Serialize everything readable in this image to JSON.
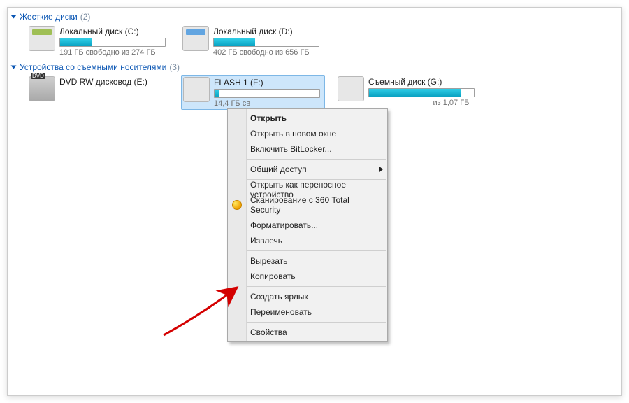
{
  "sections": {
    "hdd": {
      "title": "Жесткие диски",
      "count": "(2)"
    },
    "removable": {
      "title": "Устройства со съемными носителями",
      "count": "(3)"
    }
  },
  "drives": {
    "c": {
      "title": "Локальный диск (C:)",
      "sub": "191 ГБ свободно из 274 ГБ"
    },
    "d": {
      "title": "Локальный диск (D:)",
      "sub": "402 ГБ свободно из 656 ГБ"
    },
    "dvd": {
      "title": "DVD RW дисковод (E:)",
      "sub": ""
    },
    "f": {
      "title": "FLASH 1 (F:)",
      "sub": "14,4 ГБ св"
    },
    "g": {
      "title": "Съемный диск (G:)",
      "sub_suffix": " из 1,07 ГБ"
    }
  },
  "context_menu": {
    "open": "Открыть",
    "open_new": "Открыть в новом окне",
    "bitlocker": "Включить BitLocker...",
    "sharing": "Общий доступ",
    "portable": "Открыть как переносное устройство",
    "scan360": "Сканирование с 360 Total Security",
    "format": "Форматировать...",
    "eject": "Извлечь",
    "cut": "Вырезать",
    "copy": "Копировать",
    "shortcut": "Создать ярлык",
    "rename": "Переименовать",
    "properties": "Свойства"
  }
}
